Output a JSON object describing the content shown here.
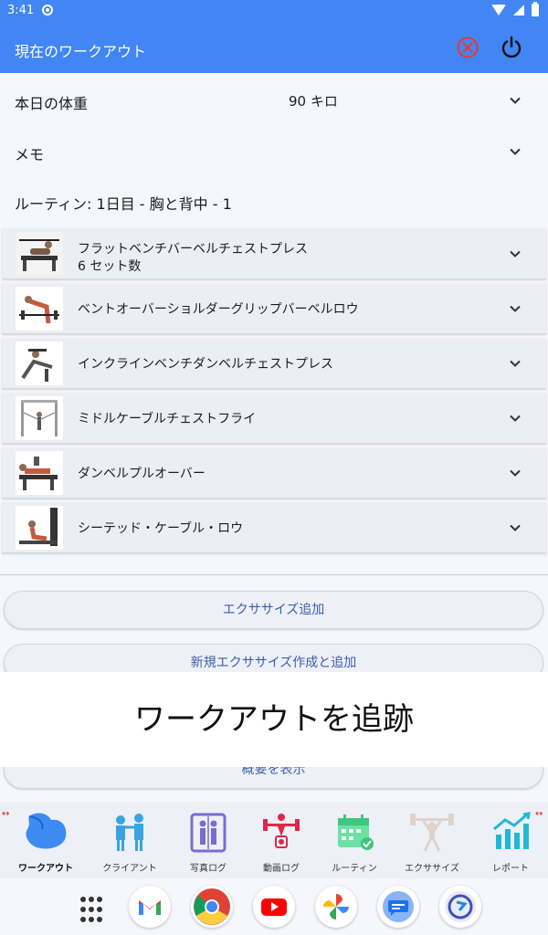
{
  "status_bar": {
    "time": "3:41"
  },
  "app_bar": {
    "title": "現在のワークアウト"
  },
  "form": {
    "weight": {
      "label": "本日の体重",
      "value": "90 キロ"
    },
    "memo": {
      "label": "メモ"
    },
    "routine": "ルーティン: 1日目 - 胸と背中 - 1"
  },
  "exercises": [
    {
      "name": "フラットベンチバーベルチェストプレス",
      "sets": "6 セット数"
    },
    {
      "name": "ベントオーバーショルダーグリップバーベルロウ"
    },
    {
      "name": "インクラインベンチダンベルチェストプレス"
    },
    {
      "name": "ミドルケーブルチェストフライ"
    },
    {
      "name": "ダンベルプルオーバー"
    },
    {
      "name": "シーテッド・ケーブル・ロウ"
    }
  ],
  "buttons": {
    "add_exercise": "エクササイズ追加",
    "create_and_add": "新規エクササイズ作成と追加",
    "show_summary": "概要を表示"
  },
  "toast": "ワークアウトを追跡",
  "bottom_nav": [
    {
      "label": "ワークアウト",
      "icon": "muscle-arm-icon",
      "active": true
    },
    {
      "label": "クライアント",
      "icon": "clients-icon"
    },
    {
      "label": "写真ログ",
      "icon": "photo-log-icon"
    },
    {
      "label": "動画ログ",
      "icon": "video-log-icon"
    },
    {
      "label": "ルーティン",
      "icon": "routine-calendar-icon"
    },
    {
      "label": "エクササイズ",
      "icon": "barbell-lifter-icon"
    },
    {
      "label": "レポート",
      "icon": "report-chart-icon"
    }
  ],
  "dock": [
    "app-drawer-icon",
    "gmail-icon",
    "chrome-icon",
    "youtube-icon",
    "photos-icon",
    "messages-icon",
    "sync-app-icon"
  ],
  "colors": {
    "primary": "#4285f4",
    "accent_red": "#e53935"
  }
}
